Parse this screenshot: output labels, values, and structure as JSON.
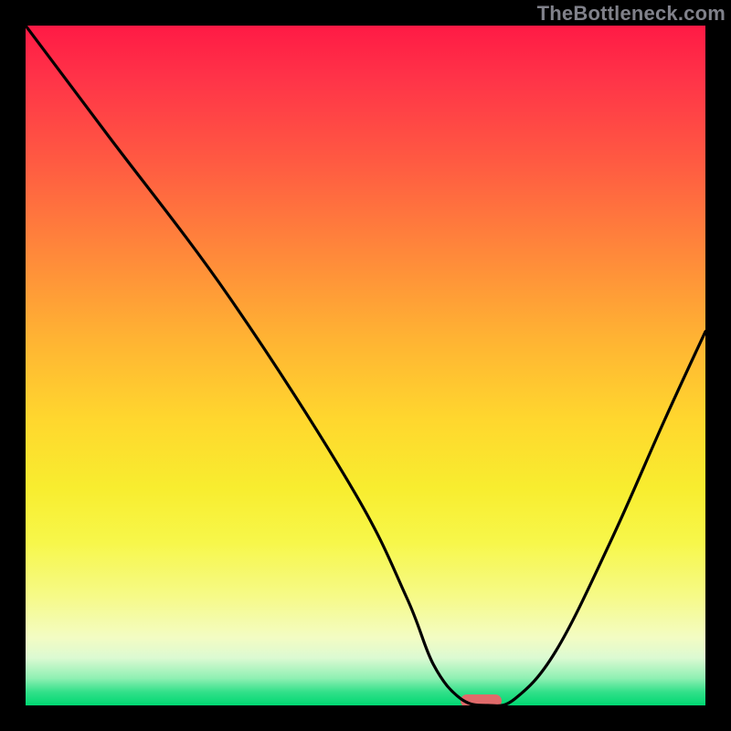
{
  "watermark": "TheBottleneck.com",
  "colors": {
    "page_bg": "#000000",
    "curve_stroke": "#000000",
    "marker_fill": "#e06a6a",
    "watermark_color": "#80818a"
  },
  "chart_data": {
    "type": "line",
    "title": "",
    "xlabel": "",
    "ylabel": "",
    "xlim": [
      0,
      100
    ],
    "ylim": [
      0,
      100
    ],
    "grid": false,
    "legend": false,
    "series": [
      {
        "name": "bottleneck-curve",
        "x": [
          0,
          12,
          30,
          48,
          56,
          60,
          64,
          68,
          72,
          78,
          86,
          94,
          100
        ],
        "values": [
          100,
          84,
          60,
          32,
          16,
          6,
          1,
          0,
          1,
          8,
          24,
          42,
          55
        ]
      }
    ],
    "marker": {
      "x_start": 64,
      "x_end": 70,
      "y": 0
    },
    "gradient_stops": [
      {
        "pos": 0,
        "color": "#ff1a45"
      },
      {
        "pos": 8,
        "color": "#ff3448"
      },
      {
        "pos": 20,
        "color": "#ff5a42"
      },
      {
        "pos": 34,
        "color": "#ff8a3a"
      },
      {
        "pos": 46,
        "color": "#ffb333"
      },
      {
        "pos": 58,
        "color": "#ffd72e"
      },
      {
        "pos": 68,
        "color": "#f8ed2f"
      },
      {
        "pos": 76,
        "color": "#f7f74a"
      },
      {
        "pos": 84,
        "color": "#f6fa88"
      },
      {
        "pos": 90,
        "color": "#f3fcc3"
      },
      {
        "pos": 93,
        "color": "#dcfad2"
      },
      {
        "pos": 96,
        "color": "#8ff0b3"
      },
      {
        "pos": 98,
        "color": "#33e08a"
      },
      {
        "pos": 100,
        "color": "#00d872"
      }
    ]
  }
}
